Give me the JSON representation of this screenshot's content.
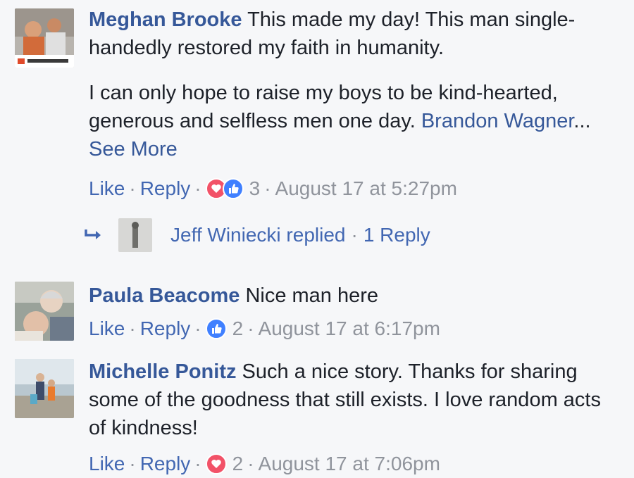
{
  "comments": [
    {
      "author": "Meghan Brooke",
      "text_lines": [
        "This made my day! This man single-handedly restored my faith in humanity."
      ],
      "paragraph2": "I can only hope to raise my boys to be kind-hearted, generous and selfless men one day.",
      "tagged": "Brandon Wagner",
      "ellipsis": "...",
      "see_more": "See More",
      "like": "Like",
      "reply": "Reply",
      "reactions": [
        "love",
        "like"
      ],
      "reaction_count": "3",
      "timestamp": "August 17 at 5:27pm",
      "replies": {
        "summary": "Jeff Winiecki replied",
        "count_label": "1 Reply"
      }
    },
    {
      "author": "Paula Beacome",
      "text": "Nice man here",
      "like": "Like",
      "reply": "Reply",
      "reactions": [
        "like"
      ],
      "reaction_count": "2",
      "timestamp": "August 17 at 6:17pm"
    },
    {
      "author": "Michelle Ponitz",
      "text": "Such a nice story. Thanks for sharing some of the goodness that still exists. I love random acts of kindness!",
      "like": "Like",
      "reply": "Reply",
      "reactions": [
        "love"
      ],
      "reaction_count": "2",
      "timestamp": "August 17 at 7:06pm"
    }
  ],
  "separator": "·",
  "colors": {
    "link": "#365899",
    "action": "#4267b2",
    "meta": "#90949c",
    "love": "#f25268",
    "like": "#4080ff",
    "background": "#f6f7f9"
  }
}
